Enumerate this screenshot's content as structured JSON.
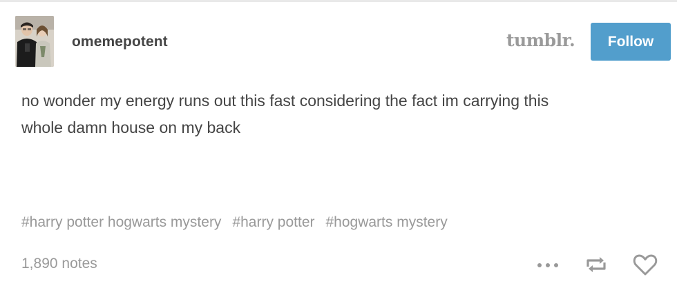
{
  "post": {
    "username": "omemepotent",
    "brand": "tumblr.",
    "follow_label": "Follow",
    "text_line1": "no wonder my energy runs out this fast considering the fact im carrying this",
    "text_line2": "whole damn house on my back",
    "tags": [
      "#harry potter hogwarts mystery",
      "#harry potter",
      "#hogwarts mystery"
    ],
    "notes": "1,890 notes"
  },
  "icons": {
    "more": "more-options-icon",
    "reblog": "reblog-icon",
    "like": "heart-icon"
  },
  "colors": {
    "accent": "#529ecc",
    "text": "#444444",
    "muted": "#999999",
    "brand": "#9a9a9a"
  }
}
